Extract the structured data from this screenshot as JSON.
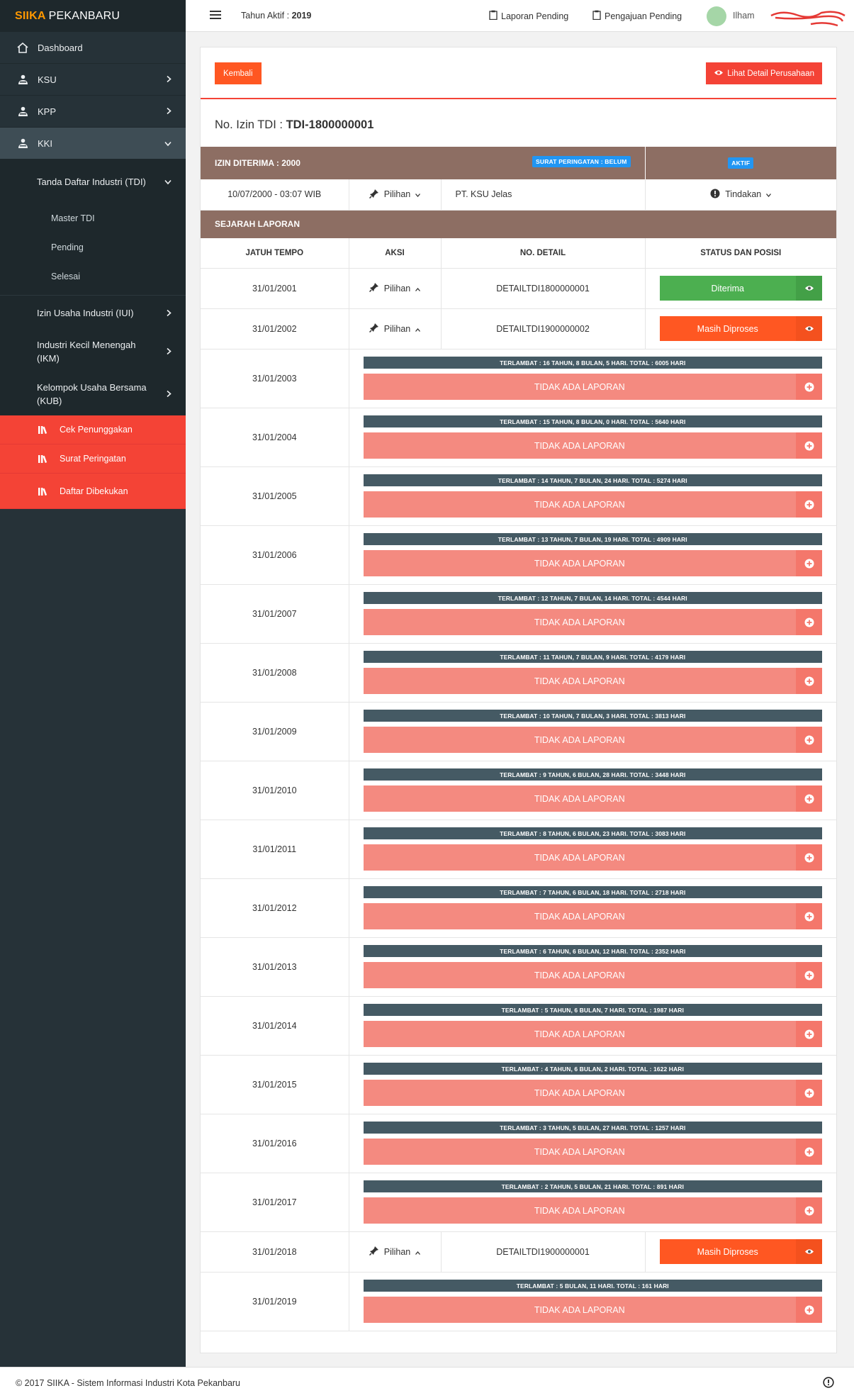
{
  "brand": {
    "accent": "SIIKA",
    "rest": "PEKANBARU"
  },
  "sidebar": {
    "dashboard": "Dashboard",
    "ksu": "KSU",
    "kpp": "KPP",
    "kki": "KKI",
    "tdi": "Tanda Daftar Industri (TDI)",
    "tdi_sub": [
      "Master TDI",
      "Pending",
      "Selesai"
    ],
    "iui": "Izin Usaha Industri (IUI)",
    "ikm": "Industri Kecil Menengah (IKM)",
    "kub": "Kelompok Usaha Bersama (KUB)",
    "red_items": [
      "Cek Penunggakan",
      "Surat Peringatan",
      "Daftar Dibekukan"
    ]
  },
  "topbar": {
    "tahun_label": "Tahun Aktif : ",
    "tahun_value": "2019",
    "laporan_pending": "Laporan Pending",
    "pengajuan_pending": "Pengajuan Pending",
    "username": "Ilham"
  },
  "card": {
    "kembali": "Kembali",
    "lihat_detail": "Lihat Detail Perusahaan",
    "izin_label": "No. Izin TDI : ",
    "izin_value": "TDI-1800000001",
    "izin_diterima": "IZIN DITERIMA : 2000",
    "surat_peringatan": "SURAT PERINGATAN : BELUM",
    "aktif": "AKTIF",
    "tanggal": "10/07/2000 - 03:07 WIB",
    "pilihan": "Pilihan",
    "perusahaan": "PT. KSU Jelas",
    "tindakan": "Tindakan",
    "sejarah": "SEJARAH LAPORAN",
    "headers": [
      "JATUH TEMPO",
      "AKSI",
      "NO. DETAIL",
      "STATUS DAN POSISI"
    ],
    "no_report": "TIDAK ADA LAPORAN"
  },
  "rows": [
    {
      "date": "31/01/2001",
      "aksi": "Pilihan",
      "detail": "DETAILTDI1800000001",
      "status": "Diterima"
    },
    {
      "date": "31/01/2002",
      "aksi": "Pilihan",
      "detail": "DETAILTDI1900000002",
      "status": "Masih Diproses"
    },
    {
      "date": "31/01/2003",
      "late": "TERLAMBAT : 16 TAHUN, 8 BULAN, 5 HARI. TOTAL : 6005 HARI"
    },
    {
      "date": "31/01/2004",
      "late": "TERLAMBAT : 15 TAHUN, 8 BULAN, 0 HARI. TOTAL : 5640 HARI"
    },
    {
      "date": "31/01/2005",
      "late": "TERLAMBAT : 14 TAHUN, 7 BULAN, 24 HARI. TOTAL : 5274 HARI"
    },
    {
      "date": "31/01/2006",
      "late": "TERLAMBAT : 13 TAHUN, 7 BULAN, 19 HARI. TOTAL : 4909 HARI"
    },
    {
      "date": "31/01/2007",
      "late": "TERLAMBAT : 12 TAHUN, 7 BULAN, 14 HARI. TOTAL : 4544 HARI"
    },
    {
      "date": "31/01/2008",
      "late": "TERLAMBAT : 11 TAHUN, 7 BULAN, 9 HARI. TOTAL : 4179 HARI"
    },
    {
      "date": "31/01/2009",
      "late": "TERLAMBAT : 10 TAHUN, 7 BULAN, 3 HARI. TOTAL : 3813 HARI"
    },
    {
      "date": "31/01/2010",
      "late": "TERLAMBAT : 9 TAHUN, 6 BULAN, 28 HARI. TOTAL : 3448 HARI"
    },
    {
      "date": "31/01/2011",
      "late": "TERLAMBAT : 8 TAHUN, 6 BULAN, 23 HARI. TOTAL : 3083 HARI"
    },
    {
      "date": "31/01/2012",
      "late": "TERLAMBAT : 7 TAHUN, 6 BULAN, 18 HARI. TOTAL : 2718 HARI"
    },
    {
      "date": "31/01/2013",
      "late": "TERLAMBAT : 6 TAHUN, 6 BULAN, 12 HARI. TOTAL : 2352 HARI"
    },
    {
      "date": "31/01/2014",
      "late": "TERLAMBAT : 5 TAHUN, 6 BULAN, 7 HARI. TOTAL : 1987 HARI"
    },
    {
      "date": "31/01/2015",
      "late": "TERLAMBAT : 4 TAHUN, 6 BULAN, 2 HARI. TOTAL : 1622 HARI"
    },
    {
      "date": "31/01/2016",
      "late": "TERLAMBAT : 3 TAHUN, 5 BULAN, 27 HARI. TOTAL : 1257 HARI"
    },
    {
      "date": "31/01/2017",
      "late": "TERLAMBAT : 2 TAHUN, 5 BULAN, 21 HARI. TOTAL : 891 HARI"
    },
    {
      "date": "31/01/2018",
      "aksi": "Pilihan",
      "detail": "DETAILTDI1900000001",
      "status": "Masih Diproses"
    },
    {
      "date": "31/01/2019",
      "late": "TERLAMBAT : 5 BULAN, 11 HARI. TOTAL : 161 HARI"
    }
  ],
  "footer": {
    "text": "© 2017 SIIKA - Sistem Informasi Industri Kota Pekanbaru"
  },
  "colors": {
    "sidebar": "#263238",
    "accent": "#ff9800",
    "red": "#f44336",
    "orange": "#ff5722",
    "green": "#4caf50",
    "brown": "#8d6e63",
    "late_bar": "#455a64",
    "no_report": "#f48a80"
  }
}
